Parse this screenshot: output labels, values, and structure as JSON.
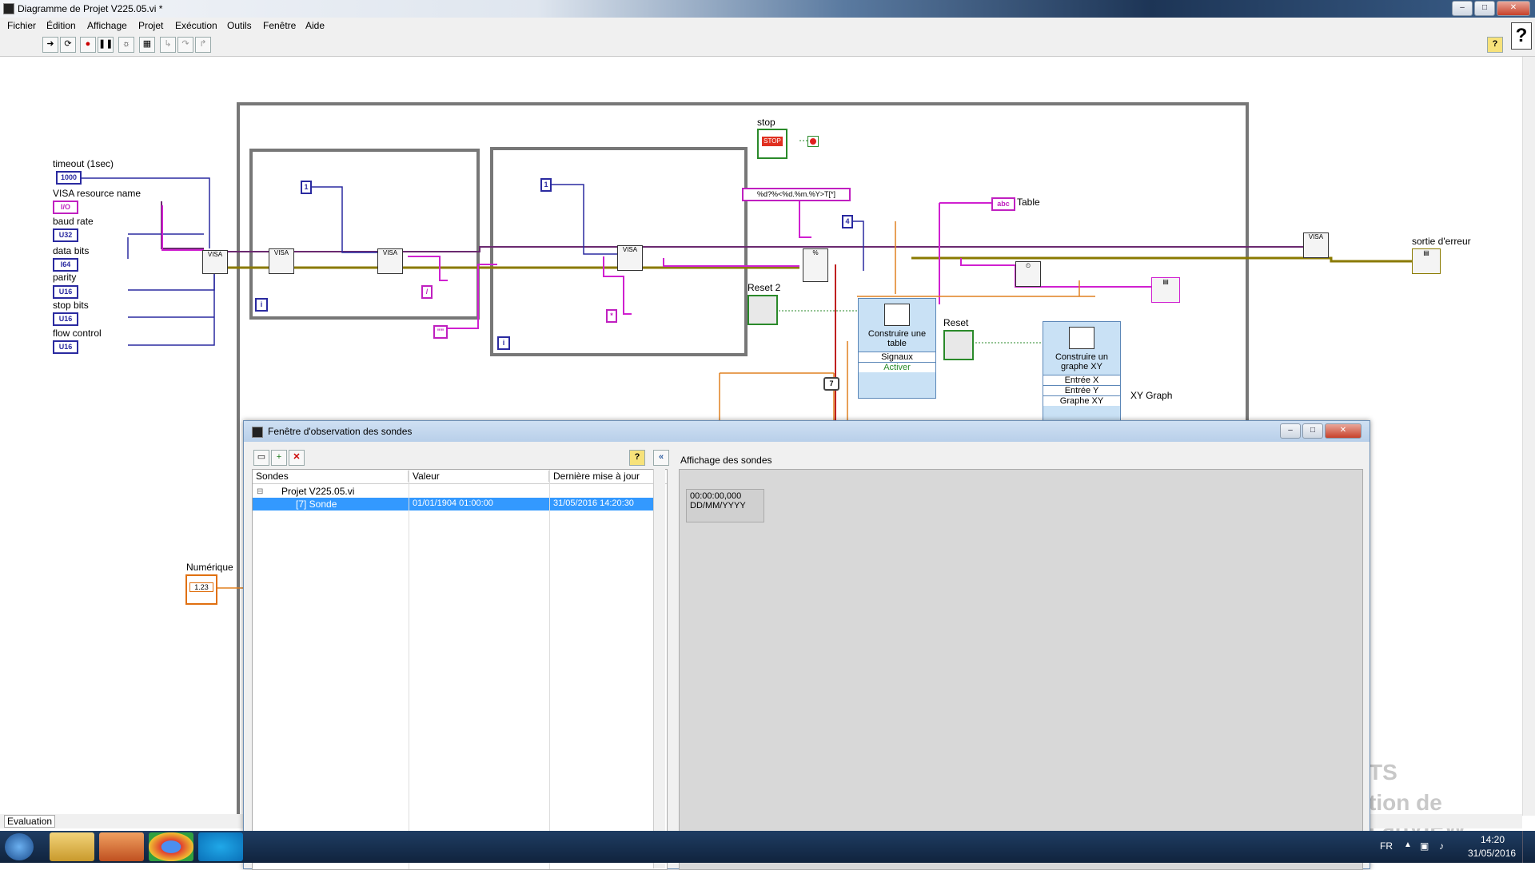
{
  "window": {
    "title": "Diagramme de Projet V225.05.vi *",
    "controls": [
      "–",
      "□",
      "✕"
    ]
  },
  "menu": [
    "Fichier",
    "Édition",
    "Affichage",
    "Projet",
    "Exécution",
    "Outils",
    "Fenêtre",
    "Aide"
  ],
  "help_glyph": "?",
  "toolbar_icons": [
    "run-arrow-icon",
    "highlight-execution-icon",
    "abort-icon",
    "pause-icon",
    "lightbulb-icon",
    "retain-wire-icon",
    "step-into-icon",
    "step-over-icon",
    "step-out-icon"
  ],
  "diagram": {
    "controls": [
      {
        "label": "timeout (1sec)",
        "value": "1000"
      },
      {
        "label": "VISA resource name",
        "value": "I/O"
      },
      {
        "label": "baud rate",
        "value": "U32"
      },
      {
        "label": "data bits",
        "value": "I64"
      },
      {
        "label": "parity",
        "value": "U16"
      },
      {
        "label": "stop bits",
        "value": "U16"
      },
      {
        "label": "flow control",
        "value": "U16"
      }
    ],
    "constants": {
      "one_a": "1",
      "one_b": "1",
      "four": "4",
      "seven": "7",
      "format": "%d?%<%d.%m.%Y>T[*]",
      "empty_str": "\"\"",
      "slash": "/",
      "star": "*",
      "iter_a": "i",
      "iter_b": "i"
    },
    "labels": {
      "stop": "stop",
      "stop_btn": "STOP",
      "reset2": "Reset 2",
      "reset": "Reset",
      "table": "Table",
      "sortie": "sortie d'erreur",
      "xy_graph": "XY Graph",
      "numerique": "Numérique",
      "numerique_val": "1.23"
    },
    "build_table": {
      "title": "Construire une table",
      "rows": [
        "Signaux",
        "Activer"
      ]
    },
    "build_xy": {
      "title": "Construire un graphe XY",
      "rows": [
        "Entrée X",
        "Entrée Y",
        "Graphe XY"
      ]
    },
    "watermark": "tion de LabVIEW",
    "watermark_ts": "TS",
    "status": "Evaluation"
  },
  "probe_window": {
    "title": "Fenêtre d'observation des sondes",
    "buttons": [
      "new-probe-icon",
      "add-probe-icon",
      "delete-probe-icon",
      "help-icon",
      "collapse-icon"
    ],
    "columns": [
      "Sondes",
      "Valeur",
      "Dernière mise à jour"
    ],
    "tree_root": "Projet V225.05.vi",
    "rows": [
      {
        "name": "[7] Sonde",
        "value": "01/01/1904 01:00:00",
        "updated": "31/05/2016 14:20:30"
      }
    ],
    "display_title": "Affichage des sondes",
    "display_line1": "00:00:00,000",
    "display_line2": "DD/MM/YYYY"
  },
  "taskbar": {
    "lang": "FR",
    "time": "14:20",
    "date": "31/05/2016"
  }
}
